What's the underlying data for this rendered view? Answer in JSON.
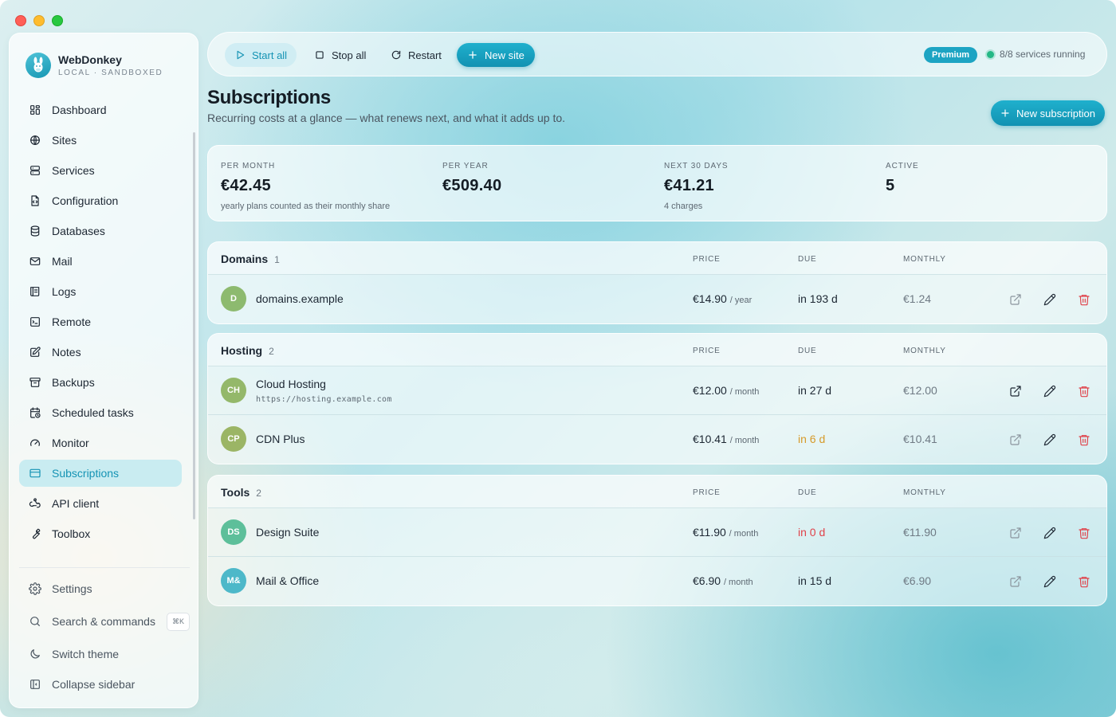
{
  "brand": {
    "name": "WebDonkey",
    "subtitle": "LOCAL · SANDBOXED"
  },
  "nav": [
    {
      "label": "Dashboard",
      "icon": "dashboard-icon"
    },
    {
      "label": "Sites",
      "icon": "globe-icon"
    },
    {
      "label": "Services",
      "icon": "server-icon"
    },
    {
      "label": "Configuration",
      "icon": "file-code-icon"
    },
    {
      "label": "Databases",
      "icon": "database-icon"
    },
    {
      "label": "Mail",
      "icon": "mail-icon"
    },
    {
      "label": "Logs",
      "icon": "logs-icon"
    },
    {
      "label": "Remote",
      "icon": "terminal-icon"
    },
    {
      "label": "Notes",
      "icon": "notes-icon"
    },
    {
      "label": "Backups",
      "icon": "archive-icon"
    },
    {
      "label": "Scheduled tasks",
      "icon": "calendar-clock-icon"
    },
    {
      "label": "Monitor",
      "icon": "gauge-icon"
    },
    {
      "label": "Subscriptions",
      "icon": "credit-card-icon",
      "active": true
    },
    {
      "label": "API client",
      "icon": "webhook-icon"
    },
    {
      "label": "Toolbox",
      "icon": "wrench-icon"
    }
  ],
  "footer": {
    "settings": "Settings",
    "search": "Search & commands",
    "search_shortcut": "⌘K",
    "theme": "Switch theme",
    "collapse": "Collapse sidebar"
  },
  "toolbar": {
    "start_all": "Start all",
    "stop_all": "Stop all",
    "restart": "Restart",
    "new_site": "New site",
    "badge": "Premium",
    "status": "8/8 services running"
  },
  "header": {
    "title": "Subscriptions",
    "subtitle": "Recurring costs at a glance — what renews next, and what it adds up to.",
    "new_button": "New subscription"
  },
  "stats": [
    {
      "label": "PER MONTH",
      "value": "€42.45",
      "note": "yearly plans counted as their monthly share"
    },
    {
      "label": "PER YEAR",
      "value": "€509.40",
      "note": ""
    },
    {
      "label": "NEXT 30 DAYS",
      "value": "€41.21",
      "note": "4 charges"
    },
    {
      "label": "ACTIVE",
      "value": "5",
      "note": ""
    }
  ],
  "columns": {
    "price": "PRICE",
    "due": "DUE",
    "monthly": "MONTHLY"
  },
  "groups": [
    {
      "name": "Domains",
      "count": "1",
      "items": [
        {
          "initials": "D",
          "name": "domains.example",
          "url": "",
          "price": "€14.90",
          "period": "/ year",
          "due": "in 193 d",
          "due_state": "normal",
          "monthly": "€1.24",
          "avatar_color": "#8dba6f"
        }
      ]
    },
    {
      "name": "Hosting",
      "count": "2",
      "items": [
        {
          "initials": "CH",
          "name": "Cloud Hosting",
          "url": "https://hosting.example.com",
          "price": "€12.00",
          "period": "/ month",
          "due": "in 27 d",
          "due_state": "normal",
          "monthly": "€12.00",
          "avatar_color": "#94b86a"
        },
        {
          "initials": "CP",
          "name": "CDN Plus",
          "url": "",
          "price": "€10.41",
          "period": "/ month",
          "due": "in 6 d",
          "due_state": "soon",
          "monthly": "€10.41",
          "avatar_color": "#9bb565"
        }
      ]
    },
    {
      "name": "Tools",
      "count": "2",
      "items": [
        {
          "initials": "DS",
          "name": "Design Suite",
          "url": "",
          "price": "€11.90",
          "period": "/ month",
          "due": "in 0 d",
          "due_state": "overdue",
          "monthly": "€11.90",
          "avatar_color": "#5dbf9a"
        },
        {
          "initials": "M&",
          "name": "Mail & Office",
          "url": "",
          "price": "€6.90",
          "period": "/ month",
          "due": "in 15 d",
          "due_state": "normal",
          "monthly": "€6.90",
          "avatar_color": "#4db8c9"
        }
      ]
    }
  ],
  "colors": {
    "accent": "#1593b4",
    "soon": "#d69a2a",
    "overdue": "#e0424a",
    "delete": "#e0424a"
  }
}
